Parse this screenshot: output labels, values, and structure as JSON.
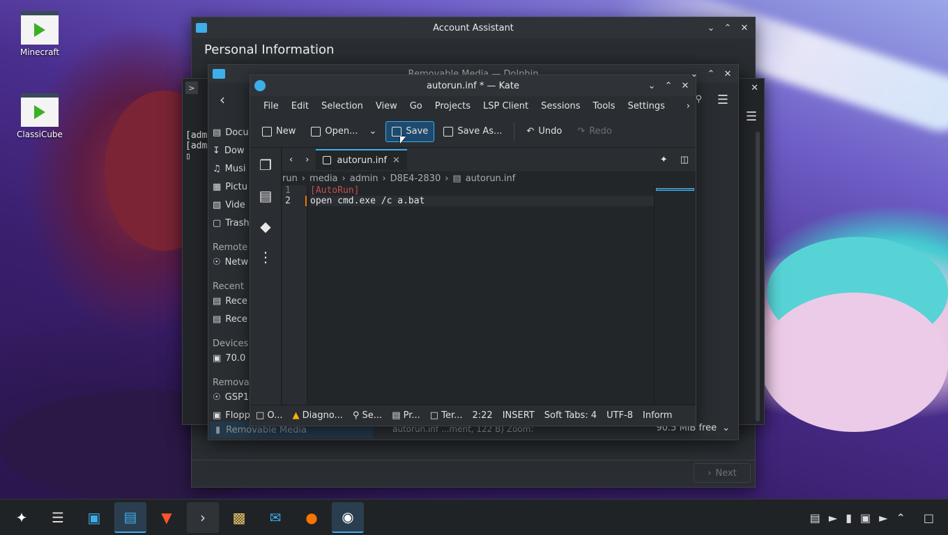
{
  "desktop": {
    "icons": [
      {
        "label": "Minecraft"
      },
      {
        "label": "ClassiCube"
      }
    ]
  },
  "account_assistant": {
    "title": "Account Assistant",
    "heading": "Personal Information",
    "next_label": "Next"
  },
  "dolphin": {
    "title": "Removable Media — Dolphin",
    "places": [
      {
        "label": "Docu",
        "group": ""
      },
      {
        "label": "Dow",
        "group": ""
      },
      {
        "label": "Musi",
        "group": ""
      },
      {
        "label": "Pictu",
        "group": ""
      },
      {
        "label": "Vide",
        "group": ""
      },
      {
        "label": "Trash",
        "group": ""
      }
    ],
    "groups": {
      "remote": "Remote",
      "recent": "Recent",
      "devices": "Devices",
      "removable": "Removal"
    },
    "remote_items": [
      "Netw"
    ],
    "recent_items": [
      "Rece",
      "Rece"
    ],
    "device_items": [
      "70.0"
    ],
    "removable_items": [
      "GSP1",
      "Flopp"
    ],
    "selected_place": "Removable Media",
    "status_text": "autorun.inf ...ment, 122 B) Zoom:",
    "free_text": "90.5 MiB free"
  },
  "terminal": {
    "lines": [
      "[adm",
      "[adm"
    ]
  },
  "kate": {
    "title": "autorun.inf * — Kate",
    "menu": [
      "File",
      "Edit",
      "Selection",
      "View",
      "Go",
      "Projects",
      "LSP Client",
      "Sessions",
      "Tools",
      "Settings"
    ],
    "toolbar": {
      "new": "New",
      "open": "Open...",
      "save": "Save",
      "save_as": "Save As...",
      "undo": "Undo",
      "redo": "Redo"
    },
    "tab": "autorun.inf",
    "breadcrumb": [
      "run",
      "media",
      "admin",
      "D8E4-2830",
      "autorun.inf"
    ],
    "lines": [
      {
        "num": "1",
        "text": "[AutoRun]"
      },
      {
        "num": "2",
        "text": "open cmd.exe /c a.bat"
      }
    ],
    "status": {
      "output": "O...",
      "diagnostics": "Diagno...",
      "search": "Se...",
      "projects": "Pr...",
      "terminal": "Ter...",
      "cursor": "2:22",
      "mode": "INSERT",
      "tabs": "Soft Tabs: 4",
      "encoding": "UTF-8",
      "mode2": "Inform"
    },
    "colors": {
      "accent": "#3daee9",
      "section": "#c0504d",
      "keyword": "#e6e6e6"
    }
  },
  "taskbar": {
    "apps": [
      "launcher",
      "settings",
      "discover",
      "dolphin",
      "brave",
      "terminal",
      "archive",
      "mail",
      "bot",
      "kate"
    ]
  }
}
